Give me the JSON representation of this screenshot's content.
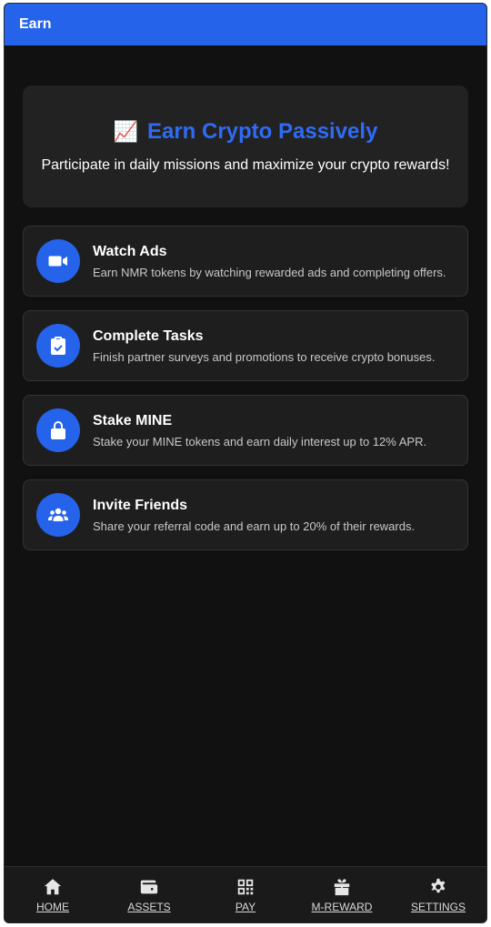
{
  "header": {
    "title": "Earn"
  },
  "hero": {
    "emoji": "📈",
    "title": "Earn Crypto Passively",
    "subtitle": "Participate in daily missions and maximize your crypto rewards!"
  },
  "cards": [
    {
      "icon": "video-camera-icon",
      "title": "Watch Ads",
      "description": "Earn NMR tokens by watching rewarded ads and completing offers."
    },
    {
      "icon": "clipboard-check-icon",
      "title": "Complete Tasks",
      "description": "Finish partner surveys and promotions to receive crypto bonuses."
    },
    {
      "icon": "lock-icon",
      "title": "Stake MINE",
      "description": "Stake your MINE tokens and earn daily interest up to 12% APR."
    },
    {
      "icon": "users-icon",
      "title": "Invite Friends",
      "description": "Share your referral code and earn up to 20% of their rewards."
    }
  ],
  "nav": [
    {
      "icon": "home-icon",
      "label": "HOME"
    },
    {
      "icon": "wallet-icon",
      "label": "ASSETS"
    },
    {
      "icon": "qr-code-icon",
      "label": "PAY"
    },
    {
      "icon": "gift-icon",
      "label": "M-REWARD"
    },
    {
      "icon": "gear-icon",
      "label": "SETTINGS"
    }
  ],
  "colors": {
    "accent": "#2563eb",
    "background": "#111111",
    "card": "#1e1e1e"
  }
}
